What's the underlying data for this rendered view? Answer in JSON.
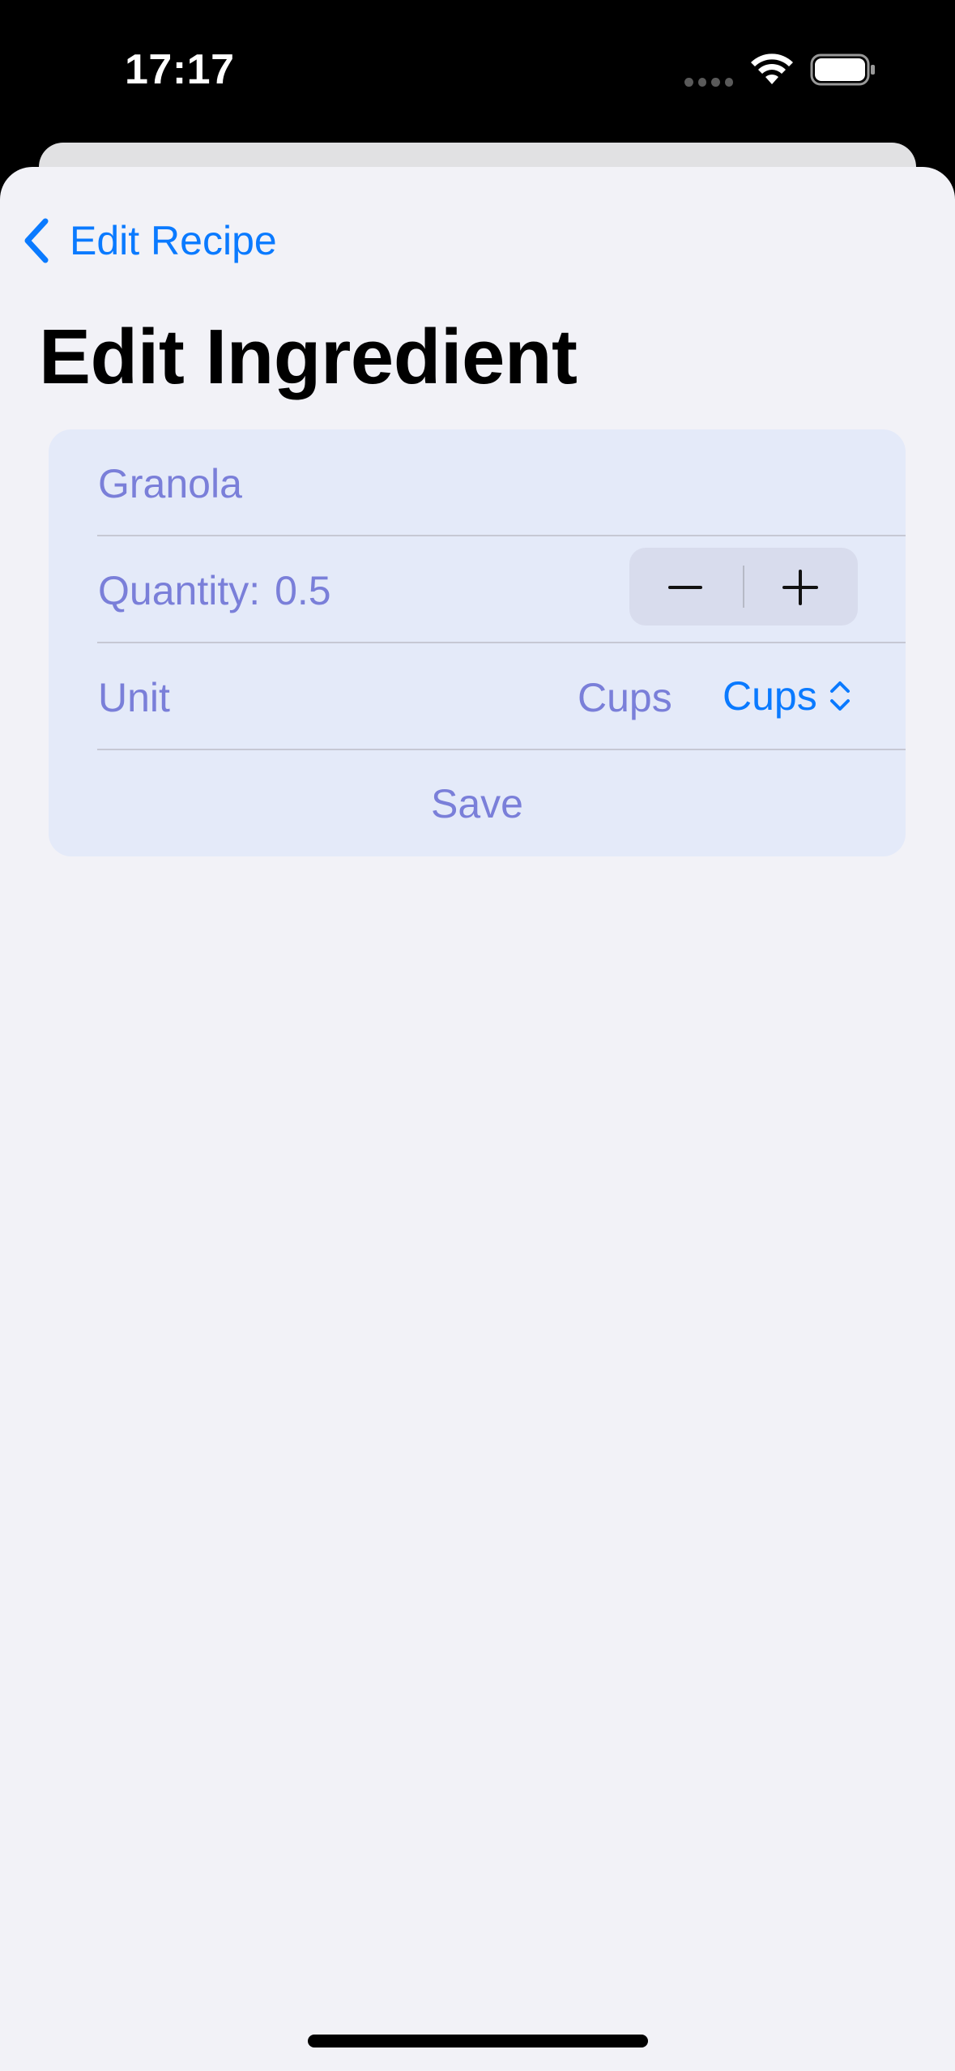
{
  "status_bar": {
    "time": "17:17",
    "icons": [
      "cellular-dots-icon",
      "wifi-icon",
      "battery-icon"
    ]
  },
  "nav": {
    "back_label": "Edit Recipe",
    "back_icon": "chevron-left-icon"
  },
  "page": {
    "title": "Edit Ingredient"
  },
  "form": {
    "name_value": "Granola",
    "quantity_label": "Quantity:",
    "quantity_value": "0.5",
    "stepper": {
      "decrement_icon": "minus-icon",
      "increment_icon": "plus-icon"
    },
    "unit_label": "Unit",
    "unit_current": "Cups",
    "unit_picker_value": "Cups",
    "unit_picker_icon": "chevron-up-down-icon",
    "save_label": "Save"
  },
  "colors": {
    "accent": "#0a7aff",
    "muted_text": "#7a7fd9",
    "form_background": "#e4eaf9",
    "sheet_background": "#f2f2f7"
  }
}
